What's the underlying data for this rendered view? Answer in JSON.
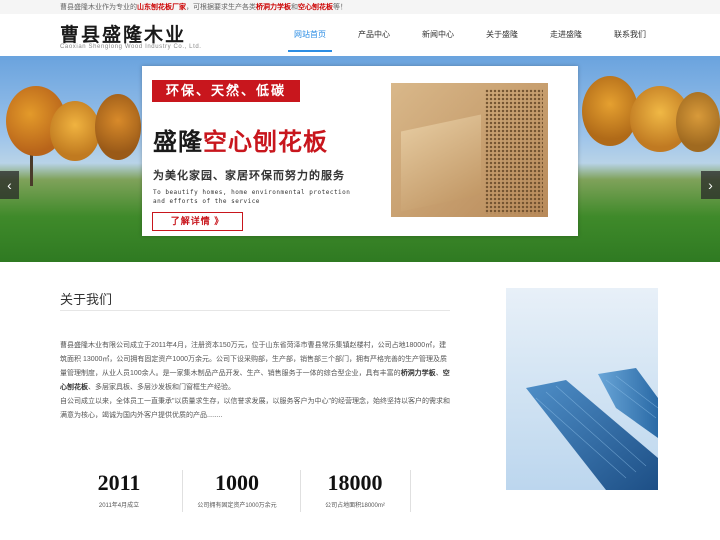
{
  "topbar": {
    "prefix": "曹县盛隆木业作为专业的",
    "hl1": "山东刨花板厂家",
    "mid": "，可根据要求生产各类",
    "hl2": "桥洞力学板",
    "and": "和",
    "hl3": "空心刨花板",
    "suffix": "等！"
  },
  "header": {
    "logo_cn": "曹县盛隆木业",
    "logo_en": "Caoxian Shenglong Wood Industry Co., Ltd."
  },
  "nav": {
    "items": [
      {
        "label": "网站首页",
        "active": true
      },
      {
        "label": "产品中心",
        "active": false
      },
      {
        "label": "新闻中心",
        "active": false
      },
      {
        "label": "关于盛隆",
        "active": false
      },
      {
        "label": "走进盛隆",
        "active": false
      },
      {
        "label": "联系我们",
        "active": false
      }
    ]
  },
  "banner": {
    "tag": "环保、天然、低碳",
    "headline_dark": "盛隆",
    "headline_red": "空心刨花板",
    "subline": "为美化家园、家居环保而努力的服务",
    "en_line": "To beautify homes, home environmental protection and efforts of the service",
    "more_label": "了解详情 》",
    "prev_icon": "chevron-left-icon",
    "next_icon": "chevron-right-icon",
    "accent_color": "#c8161d"
  },
  "about": {
    "title": "关于我们",
    "p1_a": "曹县盛隆木业有限公司成立于2011年4月，注册资本150万元，位于山东省菏泽市曹县常乐集镇赵楼村，公司占地18000㎡，建筑面积 13000㎡，公司拥有固定资产1000万余元。公司下设采购部，生产部，销售部三个部门，拥有严格完善的生产管理及质量管理制度，从业人员100余人。是一家集木制品产品开发、生产、销售服务于一体的综合型企业，具有丰富的",
    "p1_hl1": "桥洞力学板",
    "p1_sep": "、",
    "p1_hl2": "空心刨花板",
    "p1_b": "、多层家具板、多层沙发板和门窗框生产经验。",
    "p2": "自公司成立以来，全体员工一直秉承\"以质量求生存，以信誉求发展，以服务客户为中心\"的经营理念，始终坚持以客户的需求和满意为核心，竭诚为国内外客户提供优质的产品........"
  },
  "stats": [
    {
      "num": "2011",
      "cap": "2011年4月成立"
    },
    {
      "num": "1000",
      "cap": "公司拥有固定资产1000万余元"
    },
    {
      "num": "18000",
      "cap": "公司占地面积18000m²"
    }
  ],
  "colors": {
    "nav_active": "#2b8de4",
    "brand_red": "#c8161d"
  }
}
